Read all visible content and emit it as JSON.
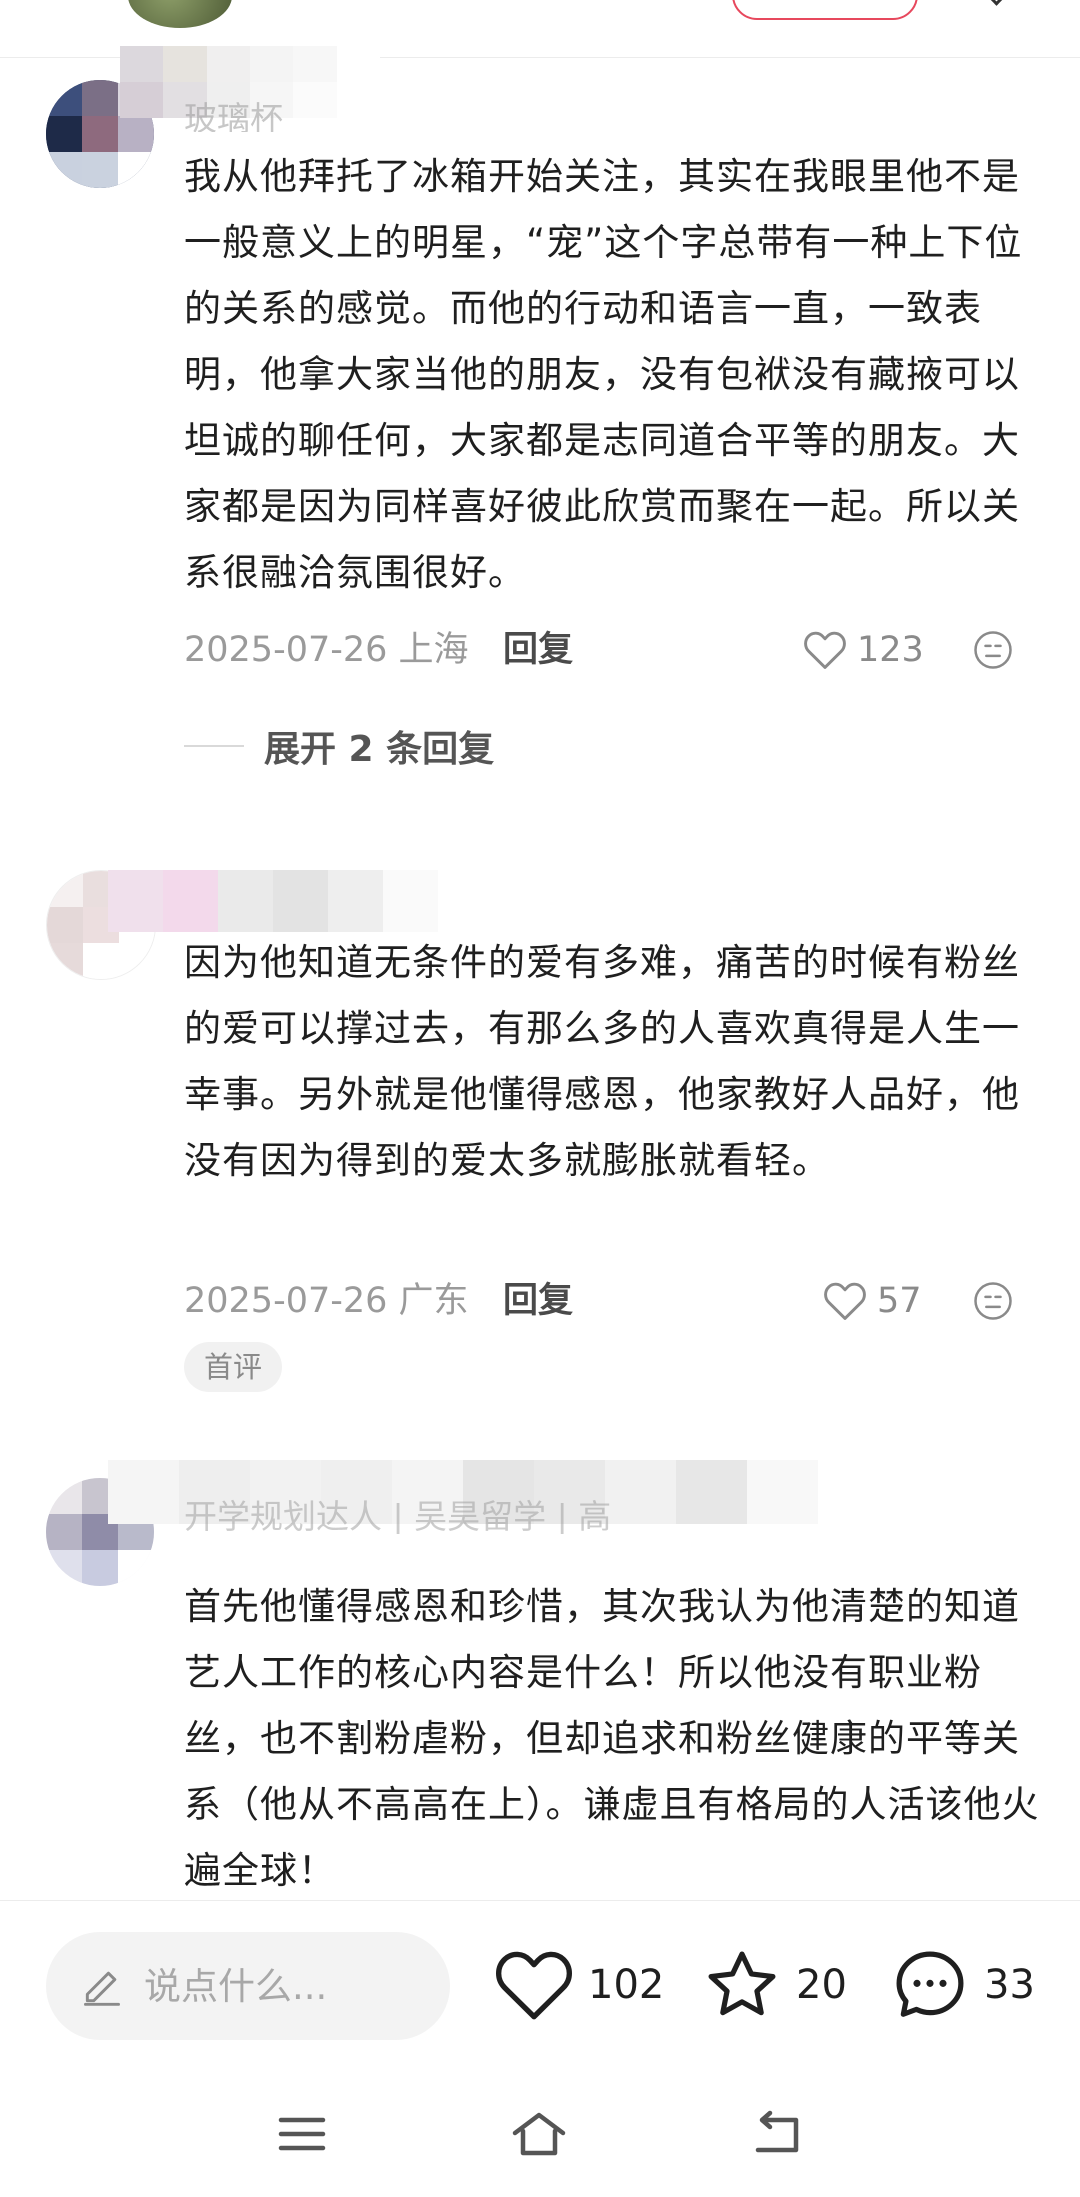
{
  "comments": [
    {
      "username": "玻璃杯",
      "text": "我从他拜托了冰箱开始关注，其实在我眼里他不是一般意义上的明星，“宠”这个字总带有一种上下位的关系的感觉。而他的行动和语言一直，一致表明，他拿大家当他的朋友，没有包袱没有藏掖可以坦诚的聊任何，大家都是志同道合平等的朋友。大家都是因为同样喜好彼此欣赏而聚在一起。所以关系很融洽氛围很好。",
      "date_location": "2025-07-26 上海",
      "reply_label": "回复",
      "like_count": "123",
      "expand_label": "展开 2 条回复"
    },
    {
      "username": "",
      "text": "因为他知道无条件的爱有多难，痛苦的时候有粉丝的爱可以撑过去，有那么多的人喜欢真得是人生一幸事。另外就是他懂得感恩，他家教好人品好，他没有因为得到的爱太多就膨胀就看轻。",
      "date_location": "2025-07-26 广东",
      "reply_label": "回复",
      "like_count": "57",
      "badge": "首评"
    },
    {
      "username": "开学规划达人 | 吴昊留学 | 高",
      "text": "首先他懂得感恩和珍惜，其次我认为他清楚的知道艺人工作的核心内容是什么！所以他没有职业粉丝，也不割粉虐粉，但却追求和粉丝健康的平等关系（他从不高高在上）。谦虚且有格局的人活该他火遍全球！"
    }
  ],
  "bottom_bar": {
    "input_placeholder": "说点什么...",
    "likes": "102",
    "favorites": "20",
    "comments": "33"
  },
  "icons": {
    "heart": "heart-icon",
    "emoji": "emoji-icon",
    "pencil": "pencil-icon",
    "star": "star-icon",
    "chat": "chat-bubble-icon",
    "menu": "menu-icon",
    "home": "home-icon",
    "back": "back-icon"
  },
  "colors": {
    "accent": "#e7485d",
    "muted_text": "#9a9a9a",
    "body_text": "#1f1f1f"
  }
}
